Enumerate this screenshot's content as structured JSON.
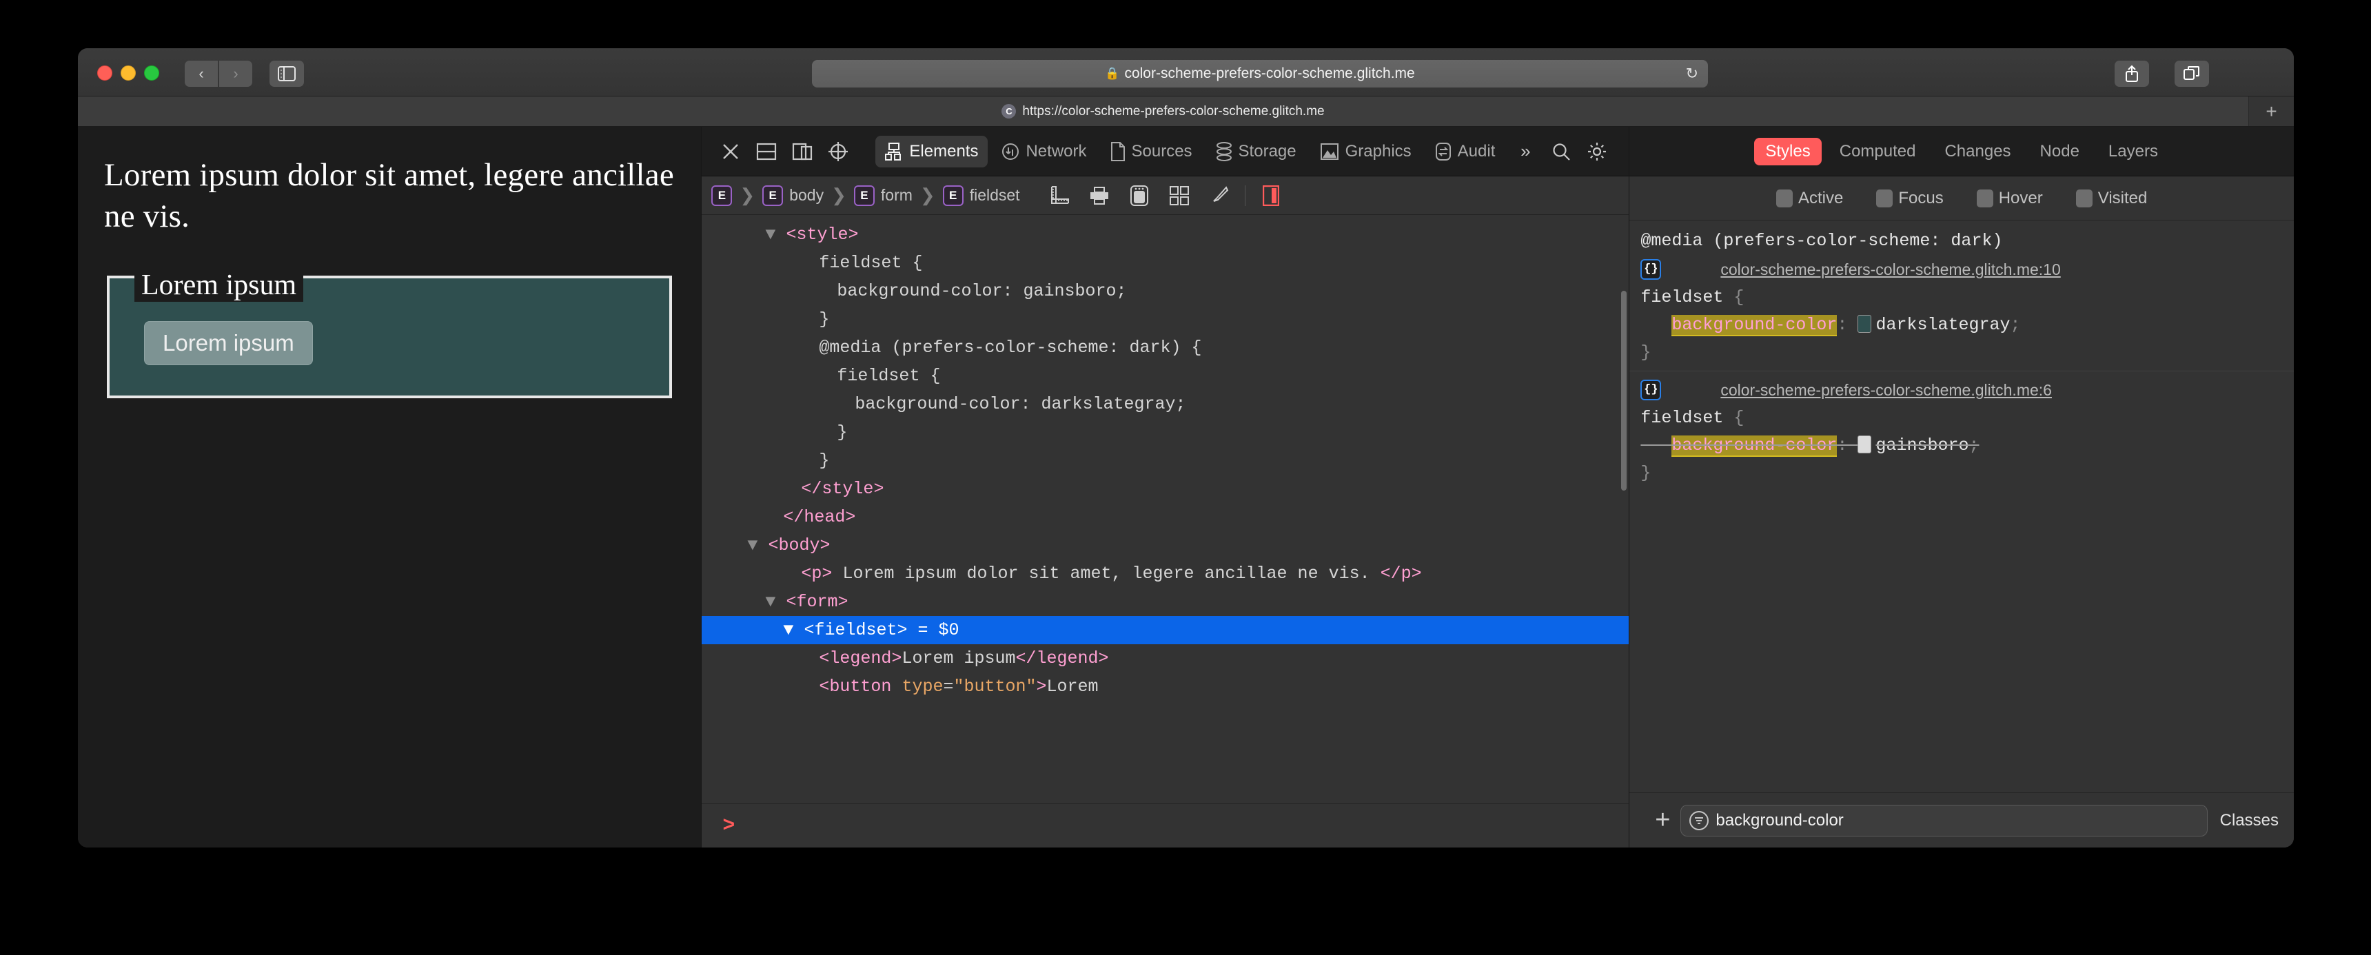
{
  "browser": {
    "traffic": [
      "close",
      "minimize",
      "maximize"
    ],
    "nav": {
      "back": "‹",
      "forward": "›"
    },
    "sidebar_icon": "sidebar-icon",
    "url": "color-scheme-prefers-color-scheme.glitch.me",
    "lock_icon": "🔒",
    "reload_icon": "↻",
    "share_icon": "share-icon",
    "tabs_icon": "tabs-icon",
    "tab": {
      "favicon_letter": "C",
      "title": "https://color-scheme-prefers-color-scheme.glitch.me"
    },
    "new_tab_label": "+"
  },
  "page": {
    "paragraph": "Lorem ipsum dolor sit amet, legere ancillae ne vis.",
    "legend": "Lorem ipsum",
    "button": "Lorem ipsum",
    "fieldset_bg": "#2f4f4f",
    "page_bg": "#1c1c1c"
  },
  "inspector": {
    "toolbar_buttons": [
      "close-inspector",
      "dock-bottom",
      "dock-right",
      "inspect-element"
    ],
    "tabs": [
      {
        "label": "Elements",
        "icon": "elements-icon",
        "active": true
      },
      {
        "label": "Network",
        "icon": "network-icon",
        "active": false
      },
      {
        "label": "Sources",
        "icon": "sources-icon",
        "active": false
      },
      {
        "label": "Storage",
        "icon": "storage-icon",
        "active": false
      },
      {
        "label": "Graphics",
        "icon": "graphics-icon",
        "active": false
      },
      {
        "label": "Audit",
        "icon": "audit-icon",
        "active": false
      }
    ],
    "more_label": "»",
    "search_icon": "search-icon",
    "settings_icon": "gear-icon",
    "breadcrumb": [
      {
        "badge": "E",
        "label": ""
      },
      {
        "badge": "E",
        "label": "body"
      },
      {
        "badge": "E",
        "label": "form"
      },
      {
        "badge": "E",
        "label": "fieldset"
      }
    ],
    "breadcrumb_separator": "❯",
    "breadcrumb_icons": [
      "ruler-icon",
      "print-icon",
      "device-icon",
      "grid-icon",
      "paint-brush-icon",
      "layout-panel-icon"
    ],
    "console_prompt": ">"
  },
  "dom": {
    "lines": [
      {
        "indent": 4,
        "twisty": "▼",
        "html": "<span class='tag'>&lt;style&gt;</span>"
      },
      {
        "indent": 6,
        "html": "<span class='txt'>fieldset {</span>"
      },
      {
        "indent": 7,
        "html": "<span class='txt'>background-color: gainsboro;</span>"
      },
      {
        "indent": 6,
        "html": "<span class='txt'>}</span>"
      },
      {
        "indent": 6,
        "html": "<span class='txt'>@media (prefers-color-scheme: dark) {</span>"
      },
      {
        "indent": 7,
        "html": "<span class='txt'>fieldset {</span>"
      },
      {
        "indent": 8,
        "html": "<span class='txt'>background-color: darkslategray;</span>"
      },
      {
        "indent": 7,
        "html": "<span class='txt'>}</span>"
      },
      {
        "indent": 6,
        "html": "<span class='txt'>}</span>"
      },
      {
        "indent": 5,
        "html": "<span class='tag'>&lt;/style&gt;</span>"
      },
      {
        "indent": 4,
        "html": "<span class='tag'>&lt;/head&gt;</span>"
      },
      {
        "indent": 3,
        "twisty": "▼",
        "html": "<span class='tag'>&lt;body&gt;</span>"
      },
      {
        "indent": 5,
        "html": "<span class='tag'>&lt;p&gt;</span> <span class='txt'>Lorem ipsum dolor sit amet, legere ancillae ne vis.</span> <span class='tag'>&lt;/p&gt;</span>"
      },
      {
        "indent": 4,
        "twisty": "▼",
        "html": "<span class='tag'>&lt;form&gt;</span>"
      },
      {
        "indent": 5,
        "twisty": "▼",
        "selected": true,
        "html": "<span class='tag'>&lt;fieldset&gt;</span> <span class='var'>= $0</span>"
      },
      {
        "indent": 6,
        "html": "<span class='tag'>&lt;legend&gt;</span><span class='txt'>Lorem ipsum</span><span class='tag'>&lt;/legend&gt;</span>"
      },
      {
        "indent": 6,
        "html": "<span class='tag'>&lt;button</span> <span class='attr'>type</span>=<span class='val'>\"button\"</span><span class='tag'>&gt;</span><span class='txt'>Lorem</span>"
      }
    ],
    "text_lines": [
      "<style>",
      "fieldset {",
      "background-color: gainsboro;",
      "}",
      "@media (prefers-color-scheme: dark) {",
      "fieldset {",
      "background-color: darkslategray;",
      "}",
      "}",
      "</style>",
      "</head>",
      "<body>",
      "<p> Lorem ipsum dolor sit amet, legere ancillae ne vis. </p>",
      "<form>",
      "<fieldset> = $0",
      "<legend>Lorem ipsum</legend>",
      "<button type=\"button\">Lorem"
    ]
  },
  "styles": {
    "tabs": [
      {
        "label": "Styles",
        "active": true
      },
      {
        "label": "Computed",
        "active": false
      },
      {
        "label": "Changes",
        "active": false
      },
      {
        "label": "Node",
        "active": false
      },
      {
        "label": "Layers",
        "active": false
      }
    ],
    "pseudo_states": [
      "Active",
      "Focus",
      "Hover",
      "Visited"
    ],
    "rules": [
      {
        "media": "@media (prefers-color-scheme: dark)",
        "source": "color-scheme-prefers-color-scheme.glitch.me:10",
        "selector": "fieldset",
        "property": "background-color",
        "value": "darkslategray",
        "swatch": "#2f4f4f",
        "overridden": false,
        "highlighted": true
      },
      {
        "media": "",
        "source": "color-scheme-prefers-color-scheme.glitch.me:6",
        "selector": "fieldset",
        "property": "background-color",
        "value": "gainsboro",
        "swatch": "#dcdcdc",
        "overridden": true,
        "highlighted": true
      }
    ],
    "add_button": "+",
    "filter_value": "background-color",
    "filter_icon": "filter-icon",
    "classes_label": "Classes"
  }
}
